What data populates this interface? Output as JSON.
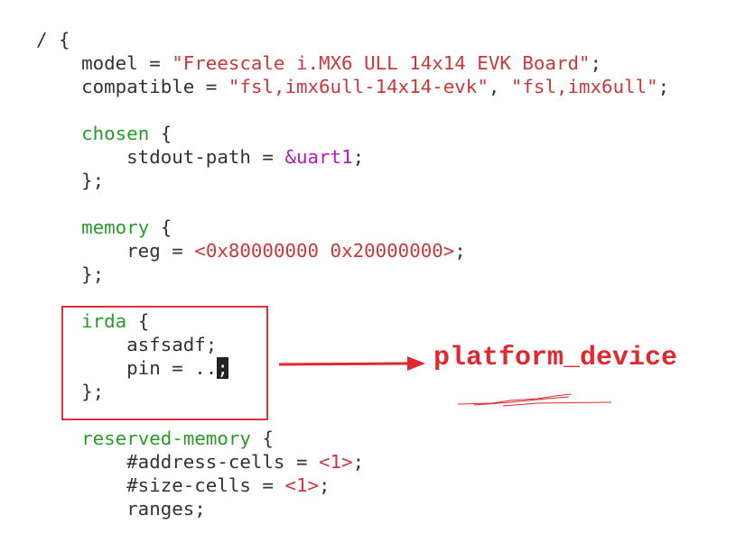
{
  "colors": {
    "string": "#c8383c",
    "node": "#2a9a2a",
    "reference": "#b21cb2",
    "annotation": "#e0282e"
  },
  "code_lines": [
    [
      {
        "t": "/ {",
        "c": "plain"
      }
    ],
    [
      {
        "t": "    model = ",
        "c": "plain"
      },
      {
        "t": "\"Freescale i.MX6 ULL 14x14 EVK Board\"",
        "c": "str"
      },
      {
        "t": ";",
        "c": "plain"
      }
    ],
    [
      {
        "t": "    compatible = ",
        "c": "plain"
      },
      {
        "t": "\"fsl,imx6ull-14x14-evk\"",
        "c": "str"
      },
      {
        "t": ", ",
        "c": "plain"
      },
      {
        "t": "\"fsl,imx6ull\"",
        "c": "str"
      },
      {
        "t": ";",
        "c": "plain"
      }
    ],
    [],
    [
      {
        "t": "    ",
        "c": "plain"
      },
      {
        "t": "chosen",
        "c": "node"
      },
      {
        "t": " {",
        "c": "plain"
      }
    ],
    [
      {
        "t": "        stdout-path = ",
        "c": "plain"
      },
      {
        "t": "&uart1",
        "c": "ref"
      },
      {
        "t": ";",
        "c": "plain"
      }
    ],
    [
      {
        "t": "    };",
        "c": "plain"
      }
    ],
    [],
    [
      {
        "t": "    ",
        "c": "plain"
      },
      {
        "t": "memory",
        "c": "node"
      },
      {
        "t": " {",
        "c": "plain"
      }
    ],
    [
      {
        "t": "        reg = ",
        "c": "plain"
      },
      {
        "t": "<0x80000000 0x20000000>",
        "c": "str"
      },
      {
        "t": ";",
        "c": "plain"
      }
    ],
    [
      {
        "t": "    };",
        "c": "plain"
      }
    ],
    [],
    [
      {
        "t": "    ",
        "c": "plain"
      },
      {
        "t": "irda",
        "c": "node"
      },
      {
        "t": " {",
        "c": "plain"
      }
    ],
    [
      {
        "t": "        asfsadf;",
        "c": "plain"
      }
    ],
    [
      {
        "t": "        pin = ..",
        "c": "plain"
      },
      {
        "t": ";",
        "c": "cursor"
      }
    ],
    [
      {
        "t": "    };",
        "c": "plain"
      }
    ],
    [],
    [
      {
        "t": "    ",
        "c": "plain"
      },
      {
        "t": "reserved-memory",
        "c": "node"
      },
      {
        "t": " {",
        "c": "plain"
      }
    ],
    [
      {
        "t": "        #address-cells = ",
        "c": "plain"
      },
      {
        "t": "<1>",
        "c": "str"
      },
      {
        "t": ";",
        "c": "plain"
      }
    ],
    [
      {
        "t": "        #size-cells = ",
        "c": "plain"
      },
      {
        "t": "<1>",
        "c": "str"
      },
      {
        "t": ";",
        "c": "plain"
      }
    ],
    [
      {
        "t": "        ranges;",
        "c": "plain"
      }
    ]
  ],
  "annotation": {
    "label": "platform_device"
  }
}
